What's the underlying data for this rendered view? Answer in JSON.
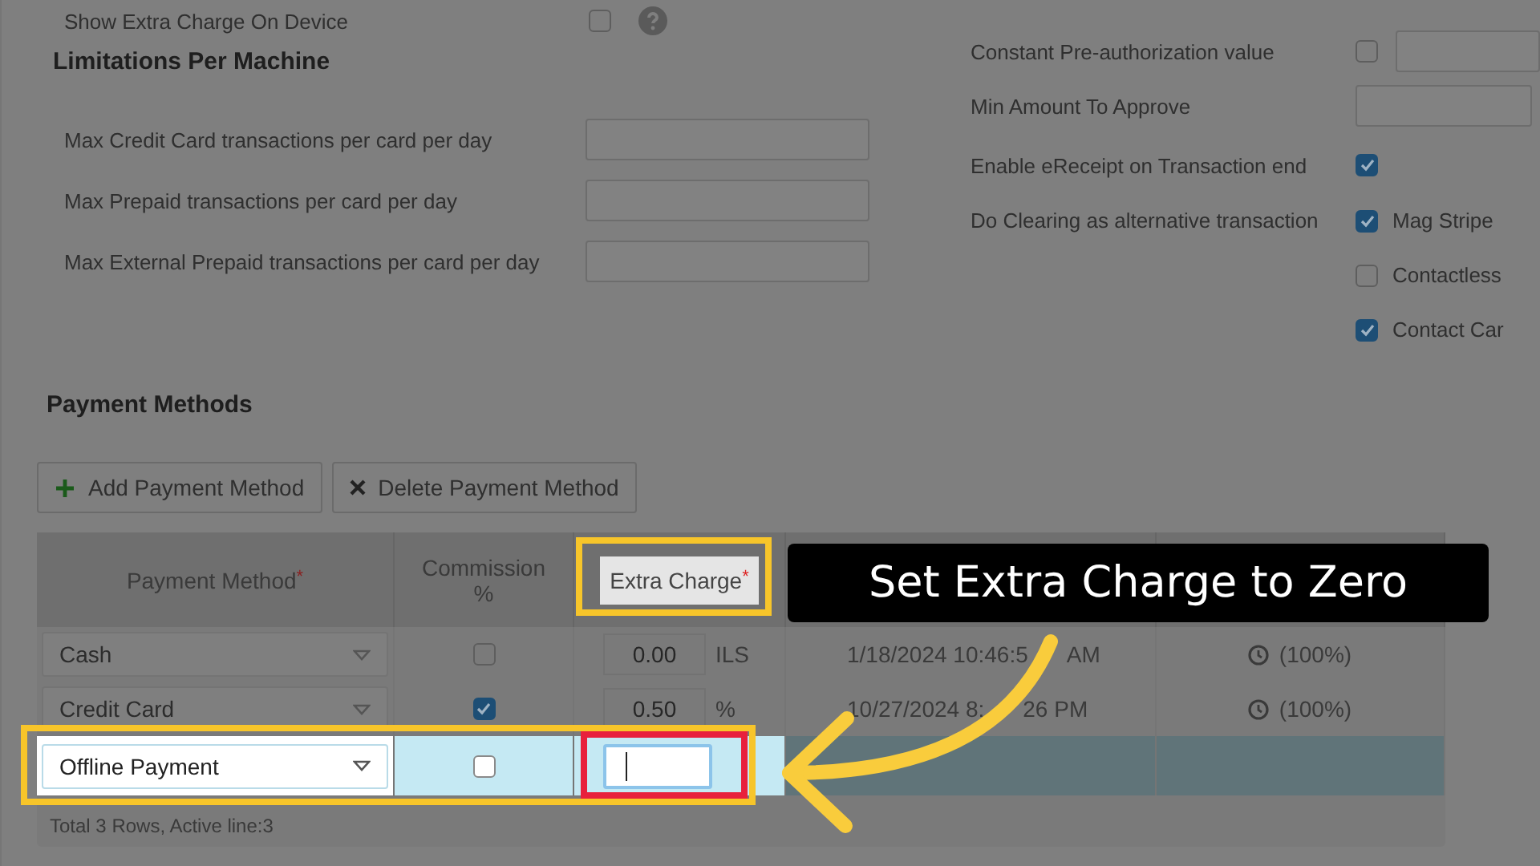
{
  "device_setting": {
    "label": "Show Extra Charge On Device",
    "checked": false
  },
  "limitations": {
    "title": "Limitations Per Machine",
    "fields": [
      {
        "label": "Max Credit Card transactions per card per day"
      },
      {
        "label": "Max Prepaid transactions per card per day"
      },
      {
        "label": "Max External Prepaid transactions per card per day"
      }
    ]
  },
  "right_settings": [
    {
      "kind": "check_input",
      "label": "Constant Pre-authorization value",
      "checked": false
    },
    {
      "kind": "input",
      "label": "Min Amount To Approve"
    },
    {
      "kind": "check",
      "label": "Enable eReceipt on Transaction end",
      "checked": true
    },
    {
      "kind": "options",
      "label": "Do Clearing as alternative transaction",
      "options": [
        {
          "label": "Mag Stripe",
          "checked": true
        },
        {
          "label": "Contactless",
          "checked": false
        },
        {
          "label": "Contact Car",
          "checked": true
        }
      ]
    }
  ],
  "payment_methods": {
    "title": "Payment Methods",
    "buttons": [
      {
        "kind": "add",
        "label": "Add Payment Method"
      },
      {
        "kind": "delete",
        "label": "Delete Payment Method"
      }
    ],
    "columns": [
      {
        "label": "Payment Method",
        "required_mark": "*"
      },
      {
        "label": "Commission %"
      },
      {
        "label": "Extra Charge",
        "required_mark": "*",
        "highlighted": true
      }
    ],
    "rows": [
      {
        "method": "Cash",
        "commission_checked": false,
        "extra_charge": "0.00",
        "unit": "ILS",
        "date_parts": [
          "1/18/2024 10:46:5",
          "AM"
        ],
        "status": "(100%)",
        "selected": false
      },
      {
        "method": "Credit Card",
        "commission_checked": true,
        "extra_charge": "0.50",
        "unit": "%",
        "date_parts": [
          "10/27/2024 8:",
          "26 PM"
        ],
        "status": "(100%)",
        "selected": false
      },
      {
        "method": "Offline Payment",
        "commission_checked": false,
        "selected": true
      }
    ],
    "footer": "Total 3 Rows, Active line:3"
  },
  "callout": {
    "text": "Set Extra Charge to Zero"
  }
}
